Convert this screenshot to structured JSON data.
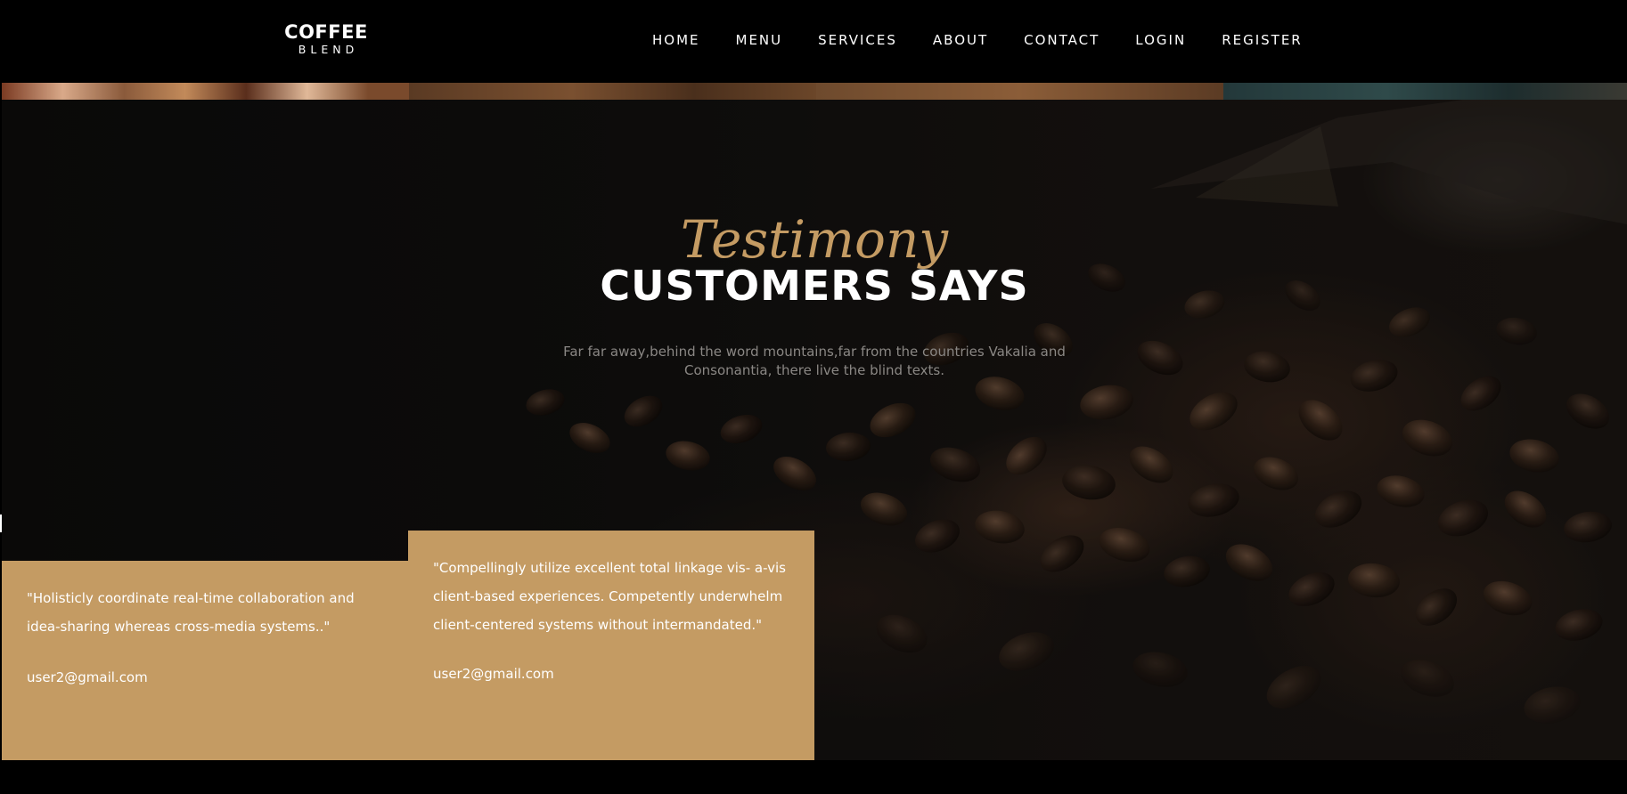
{
  "brand": {
    "name": "COFFEE",
    "tagline": "BLEND"
  },
  "nav": {
    "items": [
      {
        "label": "HOME"
      },
      {
        "label": "MENU"
      },
      {
        "label": "SERVICES"
      },
      {
        "label": "ABOUT"
      },
      {
        "label": "CONTACT"
      },
      {
        "label": "LOGIN"
      },
      {
        "label": "REGISTER"
      }
    ]
  },
  "testimony": {
    "subheading": "Testimony",
    "heading": "CUSTOMERS SAYS",
    "lead": "Far far away,behind the word mountains,far from the countries Vakalia and Consonantia, there live the blind texts.",
    "cards": [
      {
        "quote": "\"Holisticly coordinate real-time collaboration and idea-sharing whereas cross-media systems..\"",
        "author": "user2@gmail.com"
      },
      {
        "quote": "\"Compellingly utilize excellent total linkage vis- a-vis client-based experiences. Competently underwhelm client-centered systems without intermandated.\"",
        "author": "user2@gmail.com"
      }
    ]
  },
  "colors": {
    "accent": "#c49b63",
    "background": "#000000",
    "text_light": "#ffffff",
    "text_muted": "#8a8784"
  }
}
